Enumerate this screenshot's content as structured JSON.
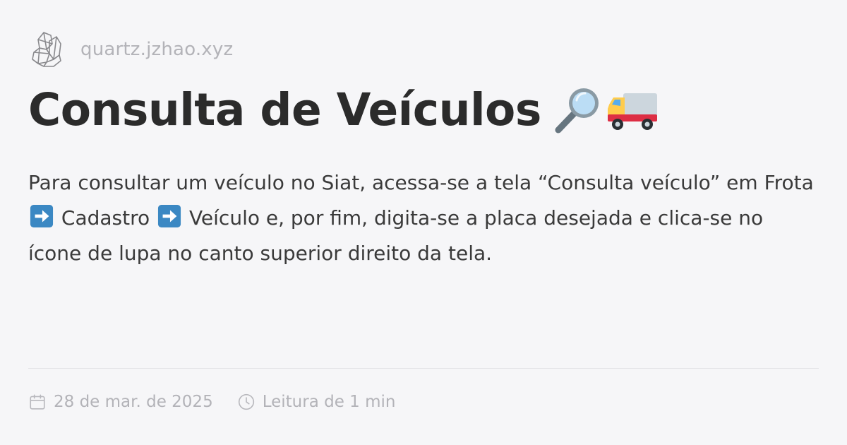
{
  "site": {
    "url": "quartz.jzhao.xyz",
    "logo_icon": "crystal-icon"
  },
  "article": {
    "title": "Consulta de Veículos",
    "title_icons": [
      "magnifying-glass-icon",
      "truck-icon"
    ],
    "description": {
      "part1": "Para consultar um veículo no Siat, acessa-se a tela “Consulta veículo” em Frota",
      "arrow_icon": "right-arrow-icon",
      "part2": " Cadastro ",
      "part3": " Veículo e, por fim, digita-se a placa desejada e clica-se no ícone de lupa no canto superior direito da tela."
    }
  },
  "meta": {
    "date_icon": "calendar-icon",
    "date": "28 de mar. de 2025",
    "reading_icon": "clock-icon",
    "reading_time": "Leitura de 1 min"
  },
  "colors": {
    "background": "#f6f6f8",
    "title": "#2b2b2b",
    "muted": "#b3b3b8",
    "arrow_blue": "#3b88c3"
  }
}
